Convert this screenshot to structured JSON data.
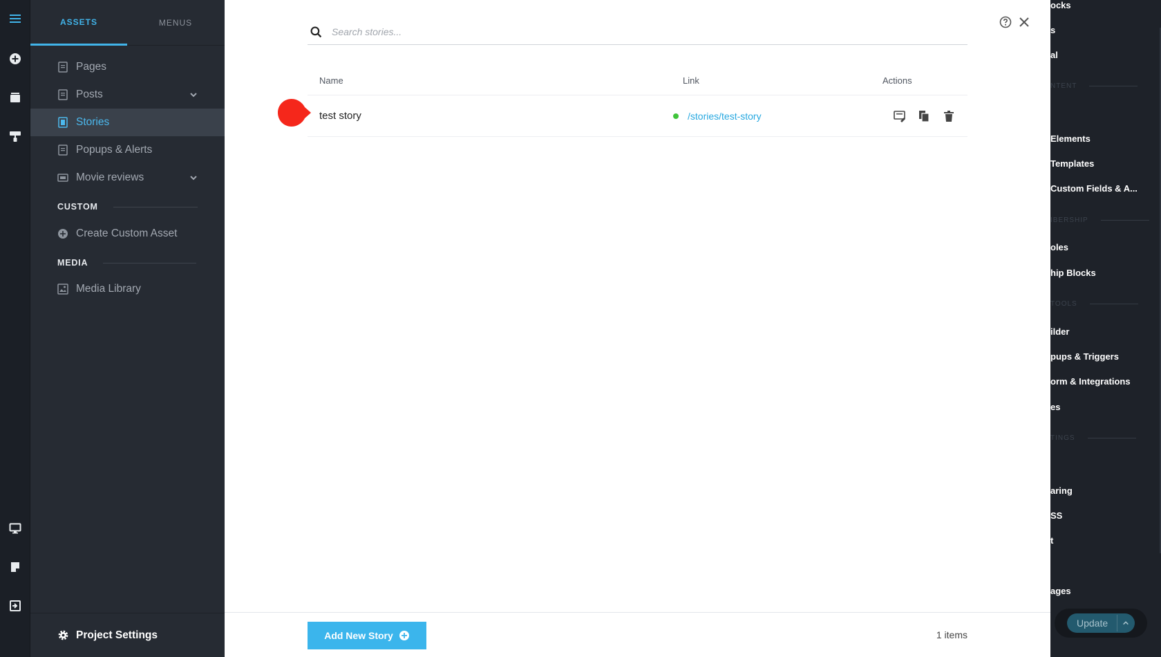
{
  "rail": {
    "icons": [
      "menu-icon",
      "add-circle-icon",
      "layers-icon",
      "paint-roller-icon",
      "desktop-icon",
      "page-note-icon",
      "exit-icon"
    ]
  },
  "sidebar": {
    "tabs": [
      {
        "label": "ASSETS",
        "active": true
      },
      {
        "label": "MENUS",
        "active": false
      }
    ],
    "items": [
      {
        "label": "Pages"
      },
      {
        "label": "Posts"
      },
      {
        "label": "Stories"
      },
      {
        "label": "Popups & Alerts"
      },
      {
        "label": "Movie reviews"
      }
    ],
    "custom_label": "CUSTOM",
    "create_custom_asset": "Create Custom Asset",
    "media_label": "MEDIA",
    "media_library": "Media Library",
    "project_settings": "Project Settings"
  },
  "right_panel": {
    "lines": [
      {
        "text": "ocks",
        "kind": "item"
      },
      {
        "text": "s",
        "kind": "item"
      },
      {
        "text": "al",
        "kind": "item"
      },
      {
        "text": "NTENT",
        "kind": "heading"
      },
      {
        "text": "Elements",
        "kind": "item"
      },
      {
        "text": "Templates",
        "kind": "item"
      },
      {
        "text": "Custom Fields & A...",
        "kind": "item"
      },
      {
        "text": "IBERSHIP",
        "kind": "heading"
      },
      {
        "text": "oles",
        "kind": "item"
      },
      {
        "text": "hip Blocks",
        "kind": "item"
      },
      {
        "text": "TOOLS",
        "kind": "heading"
      },
      {
        "text": "ilder",
        "kind": "item"
      },
      {
        "text": "pups & Triggers",
        "kind": "item"
      },
      {
        "text": "orm & Integrations",
        "kind": "item"
      },
      {
        "text": "es",
        "kind": "item"
      },
      {
        "text": "TINGS",
        "kind": "heading"
      },
      {
        "text": "aring",
        "kind": "item"
      },
      {
        "text": "SS",
        "kind": "item"
      },
      {
        "text": "t",
        "kind": "item"
      },
      {
        "text": "ages",
        "kind": "item"
      }
    ],
    "update_label": "Update"
  },
  "modal": {
    "search_placeholder": "Search stories...",
    "columns": {
      "name": "Name",
      "link": "Link",
      "actions": "Actions"
    },
    "rows": [
      {
        "name": "test story",
        "link": "/stories/test-story",
        "status": "published"
      }
    ],
    "add_button": "Add New Story",
    "items_count": "1 items"
  },
  "colors": {
    "accent": "#3bb5ec",
    "status_published": "#3fc43a",
    "marker": "#f5271b",
    "sidebar_bg": "#262b33"
  }
}
